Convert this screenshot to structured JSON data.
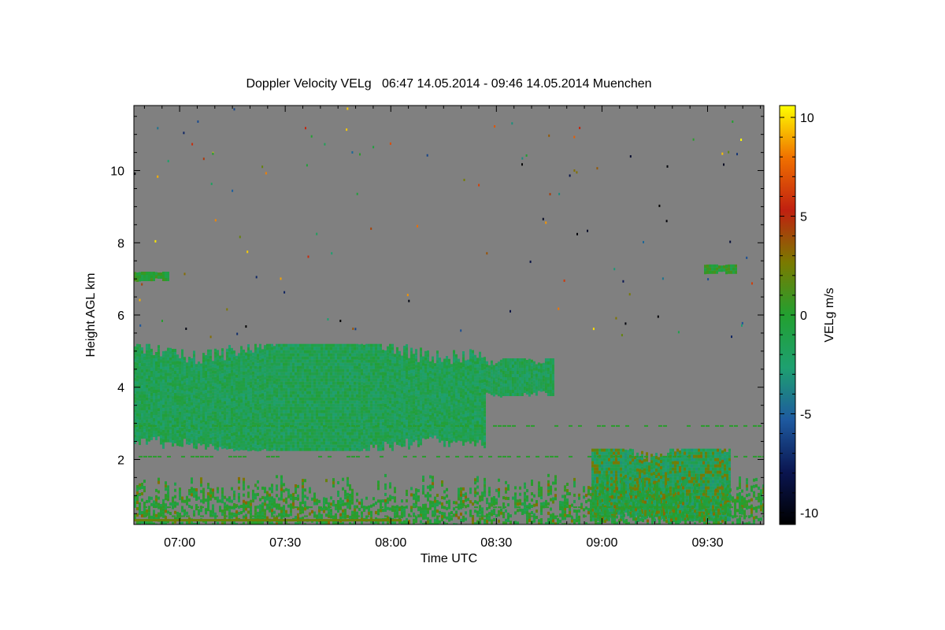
{
  "chart_data": {
    "type": "heatmap",
    "title": "Doppler Velocity VELg   06:47 14.05.2014 - 09:46 14.05.2014 Muenchen",
    "xlabel": "Time UTC",
    "ylabel": "Height AGL km",
    "x_ticks": [
      "07:00",
      "07:30",
      "08:00",
      "08:30",
      "09:00",
      "09:30"
    ],
    "y_ticks": [
      "2",
      "4",
      "6",
      "8",
      "10"
    ],
    "xlim": [
      "06:47",
      "09:46"
    ],
    "ylim": [
      0.2,
      11.8
    ],
    "colorbar": {
      "label": "VELg m/s",
      "ticks": [
        "10",
        "5",
        "0",
        "-5",
        "-10"
      ],
      "range": [
        -10.6,
        10.6
      ],
      "colors": [
        "#000000",
        "#0a1550",
        "#1e5aa0",
        "#1ea070",
        "#22a030",
        "#7a7a00",
        "#c02010",
        "#f07000",
        "#ffff00"
      ]
    },
    "background_color": "#808080",
    "regions": [
      {
        "t0": "06:47",
        "t1": "08:27",
        "h0": 2.3,
        "h1": 5.2,
        "mean_velocity": -1.5
      },
      {
        "t0": "08:27",
        "t1": "08:46",
        "h0": 3.8,
        "h1": 4.8,
        "mean_velocity": -1.5
      },
      {
        "t0": "06:47",
        "t1": "06:57",
        "h0": 7.0,
        "h1": 7.2,
        "mean_velocity": 0
      },
      {
        "t0": "09:29",
        "t1": "09:38",
        "h0": 7.2,
        "h1": 7.4,
        "mean_velocity": 0
      },
      {
        "t0": "08:57",
        "t1": "09:36",
        "h0": 0.3,
        "h1": 2.3,
        "mean_velocity": -2
      }
    ]
  }
}
